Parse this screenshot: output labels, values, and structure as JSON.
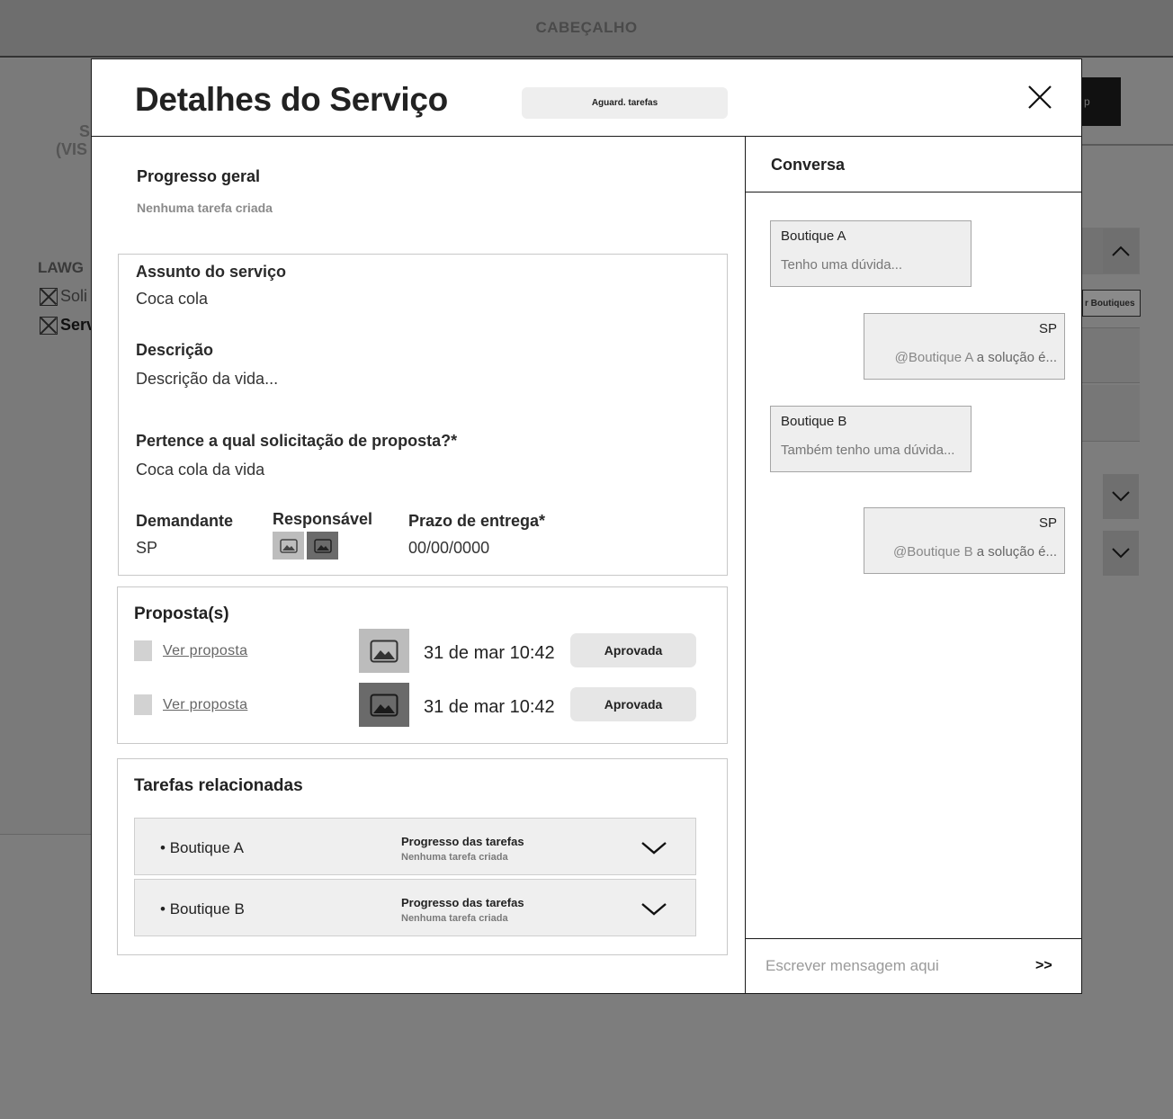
{
  "background": {
    "header_label": "CABEÇALHO",
    "fragment_s": "S",
    "fragment_vis": "(VIS",
    "fragment_lawg": "LAWG",
    "fragment_soli": "Soli",
    "fragment_serv": "Serv",
    "fragment_right_black": "p",
    "fragment_right_btn": "r Boutiques"
  },
  "modal": {
    "title": "Detalhes do Serviço",
    "status_badge": "Aguard. tarefas",
    "progress": {
      "title": "Progresso geral",
      "subtitle": "Nenhuma tarefa criada"
    },
    "details": {
      "subject_label": "Assunto do serviço",
      "subject_value": "Coca cola",
      "description_label": "Descrição",
      "description_value": "Descrição da vida...",
      "proposal_request_label": "Pertence a qual solicitação de proposta?*",
      "proposal_request_value": "Coca cola da vida",
      "requester_label": "Demandante",
      "requester_value": "SP",
      "responsible_label": "Responsável",
      "deadline_label": "Prazo de entrega*",
      "deadline_value": "00/00/0000"
    },
    "proposals": {
      "title": "Proposta(s)",
      "items": [
        {
          "link": "Ver proposta",
          "date": "31 de mar 10:42",
          "status": "Aprovada"
        },
        {
          "link": "Ver proposta",
          "date": "31 de mar 10:42",
          "status": "Aprovada"
        }
      ]
    },
    "tasks": {
      "title": "Tarefas relacionadas",
      "items": [
        {
          "name": "Boutique A",
          "progress_title": "Progresso das tarefas",
          "progress_sub": "Nenhuma tarefa criada"
        },
        {
          "name": "Boutique B",
          "progress_title": "Progresso das tarefas",
          "progress_sub": "Nenhuma tarefa criada"
        }
      ]
    }
  },
  "chat": {
    "title": "Conversa",
    "messages": [
      {
        "sender": "Boutique A",
        "text": "Tenho uma dúvida..."
      },
      {
        "sender": "SP",
        "mention": "@Boutique A",
        "text": " a solução é..."
      },
      {
        "sender": "Boutique B",
        "text": "Também tenho uma dúvida..."
      },
      {
        "sender": "SP",
        "mention": "@Boutique B",
        "text": " a solução é..."
      }
    ],
    "input_placeholder": "Escrever mensagem aqui",
    "send_label": ">>"
  }
}
